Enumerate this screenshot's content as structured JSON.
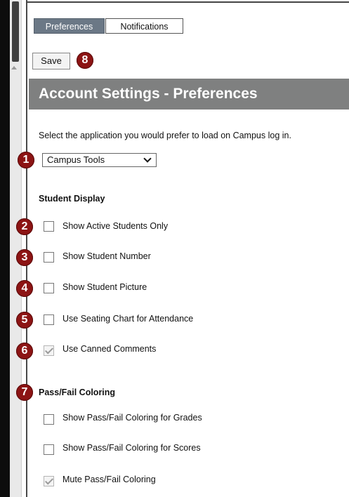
{
  "tabs": [
    {
      "label": "Preferences",
      "active": true
    },
    {
      "label": "Notifications",
      "active": false
    }
  ],
  "toolbar": {
    "save_label": "Save"
  },
  "page_title": "Account Settings - Preferences",
  "instruction": "Select the application you would prefer to load on Campus log in.",
  "app_select": {
    "selected": "Campus Tools"
  },
  "student_display": {
    "heading": "Student Display",
    "options": [
      {
        "label": "Show Active Students Only",
        "checked": false
      },
      {
        "label": "Show Student Number",
        "checked": false
      },
      {
        "label": "Show Student Picture",
        "checked": false
      },
      {
        "label": "Use Seating Chart for Attendance",
        "checked": false
      },
      {
        "label": "Use Canned Comments",
        "checked": true
      }
    ]
  },
  "pass_fail": {
    "heading": "Pass/Fail Coloring",
    "options": [
      {
        "label": "Show Pass/Fail Coloring for Grades",
        "checked": false
      },
      {
        "label": "Show Pass/Fail Coloring for Scores",
        "checked": false
      },
      {
        "label": "Mute Pass/Fail Coloring",
        "checked": true
      }
    ]
  },
  "callouts": [
    "1",
    "2",
    "3",
    "4",
    "5",
    "6",
    "7",
    "8"
  ],
  "colors": {
    "callout": "#8c1414",
    "title_bar": "#7f8080",
    "active_tab": "#6b7886"
  }
}
